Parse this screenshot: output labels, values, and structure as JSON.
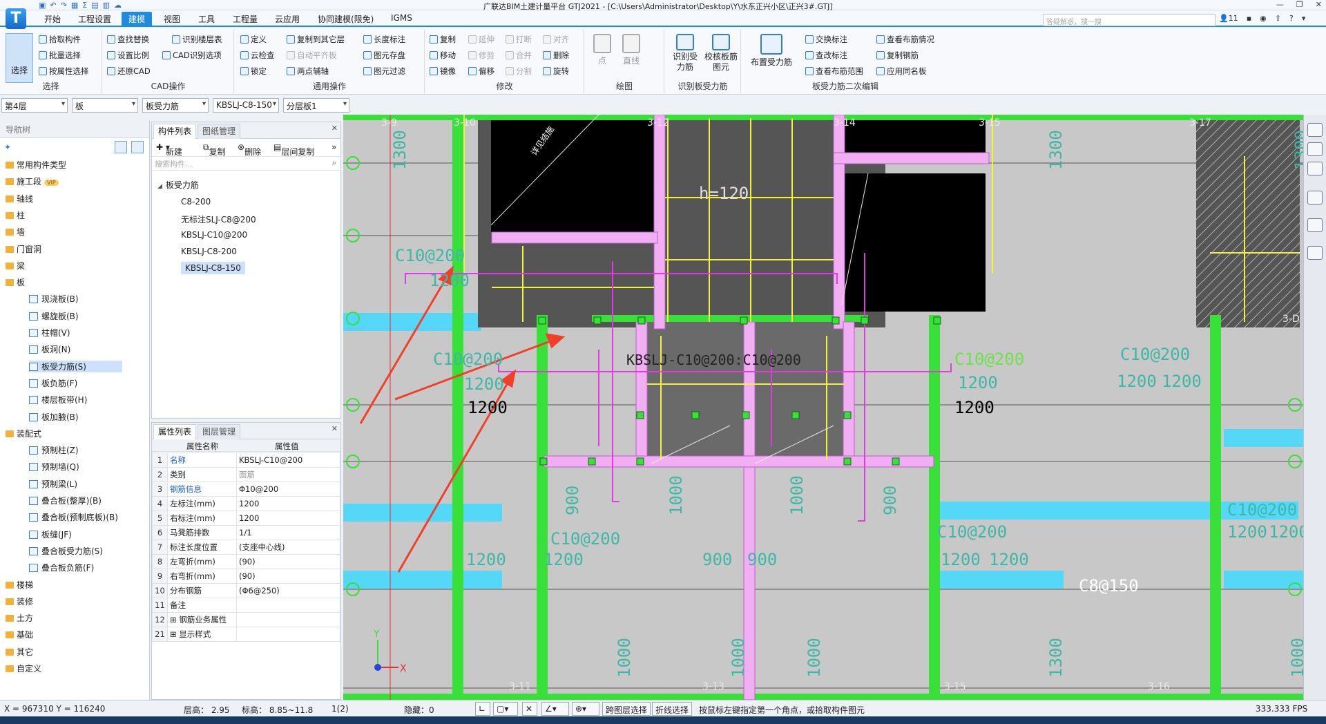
{
  "window": {
    "title": "广联达BIM土建计量平台 GTJ2021 - [C:\\Users\\Administrator\\Desktop\\Y\\水东正兴小区\\正兴3#.GTJ]",
    "logo": "T"
  },
  "menu": [
    "开始",
    "工程设置",
    "建模",
    "视图",
    "工具",
    "工程量",
    "云应用",
    "协同建模(限免)",
    "IGMS"
  ],
  "search_placeholder": "答疑解惑，搜一搜",
  "user_count": "11",
  "ribbon": {
    "select": {
      "big": "选择",
      "items": [
        "拾取构件",
        "批量选择",
        "按属性选择"
      ],
      "title": "选择"
    },
    "cad": {
      "items": [
        "查找替换",
        "识别楼层表",
        "设置比例",
        "CAD识别选项",
        "还原CAD"
      ],
      "title": "CAD操作"
    },
    "common": {
      "items": [
        "定义",
        "复制到其它层",
        "长度标注",
        "云检查",
        "自动平齐板",
        "图元存盘",
        "锁定",
        "两点辅轴",
        "图元过滤"
      ],
      "title": "通用操作"
    },
    "modify": {
      "items": [
        "复制",
        "延伸",
        "打断",
        "对齐",
        "移动",
        "修剪",
        "合并",
        "删除",
        "镜像",
        "偏移",
        "分割",
        "旋转"
      ],
      "title": "修改"
    },
    "draw": {
      "items": [
        "点",
        "直线"
      ],
      "title": "绘图"
    },
    "identify": {
      "items": [
        "识别受力筋",
        "校核板筋图元"
      ],
      "title": "识别板受力筋"
    },
    "edit": {
      "big": "布置受力筋",
      "items": [
        "交换标注",
        "查看布筋情况",
        "查改标注",
        "复制钢筋",
        "查看布筋范围",
        "应用同名板"
      ],
      "title": "板受力筋二次编辑"
    }
  },
  "combos": [
    "第4层",
    "板",
    "板受力筋",
    "KBSLJ-C8-150",
    "分层板1"
  ],
  "nav": {
    "title": "导航树",
    "items": [
      {
        "label": "常用构件类型",
        "level": 0
      },
      {
        "label": "施工段",
        "level": 0,
        "badge": "VIP"
      },
      {
        "label": "轴线",
        "level": 0
      },
      {
        "label": "柱",
        "level": 0
      },
      {
        "label": "墙",
        "level": 0
      },
      {
        "label": "门窗洞",
        "level": 0
      },
      {
        "label": "梁",
        "level": 0
      },
      {
        "label": "板",
        "level": 0
      },
      {
        "label": "现浇板(B)",
        "level": 1
      },
      {
        "label": "螺旋板(B)",
        "level": 1
      },
      {
        "label": "柱帽(V)",
        "level": 1
      },
      {
        "label": "板洞(N)",
        "level": 1
      },
      {
        "label": "板受力筋(S)",
        "level": 1,
        "selected": true
      },
      {
        "label": "板负筋(F)",
        "level": 1
      },
      {
        "label": "楼层板带(H)",
        "level": 1
      },
      {
        "label": "板加腋(B)",
        "level": 1
      },
      {
        "label": "装配式",
        "level": 0
      },
      {
        "label": "预制柱(Z)",
        "level": 1
      },
      {
        "label": "预制墙(Q)",
        "level": 1
      },
      {
        "label": "预制梁(L)",
        "level": 1
      },
      {
        "label": "叠合板(整厚)(B)",
        "level": 1
      },
      {
        "label": "叠合板(预制底板)(B)",
        "level": 1
      },
      {
        "label": "板缝(JF)",
        "level": 1
      },
      {
        "label": "叠合板受力筋(S)",
        "level": 1
      },
      {
        "label": "叠合板负筋(F)",
        "level": 1
      },
      {
        "label": "楼梯",
        "level": 0
      },
      {
        "label": "装修",
        "level": 0
      },
      {
        "label": "土方",
        "level": 0
      },
      {
        "label": "基础",
        "level": 0
      },
      {
        "label": "其它",
        "level": 0
      },
      {
        "label": "自定义",
        "level": 0
      }
    ]
  },
  "components": {
    "tabs": [
      "构件列表",
      "图纸管理"
    ],
    "toolbar": [
      "新建",
      "复制",
      "删除",
      "层间复制"
    ],
    "filter_placeholder": "搜索构件...",
    "group": "板受力筋",
    "items": [
      "C8-200",
      "无标注SLJ-C8@200",
      "KBSLJ-C10@200",
      "KBSLJ-C8-200",
      "KBSLJ-C8-150"
    ]
  },
  "props": {
    "tabs": [
      "属性列表",
      "图层管理"
    ],
    "header": [
      "属性名称",
      "属性值"
    ],
    "rows": [
      {
        "n": "1",
        "k": "名称",
        "v": "KBSLJ-C10@200",
        "blue": true
      },
      {
        "n": "2",
        "k": "类别",
        "v": "面筋",
        "gray": true
      },
      {
        "n": "3",
        "k": "钢筋信息",
        "v": "Φ10@200",
        "blue": true
      },
      {
        "n": "4",
        "k": "左标注(mm)",
        "v": "1200"
      },
      {
        "n": "5",
        "k": "右标注(mm)",
        "v": "1200"
      },
      {
        "n": "6",
        "k": "马凳筋排数",
        "v": "1/1"
      },
      {
        "n": "7",
        "k": "标注长度位置",
        "v": "(支座中心线)"
      },
      {
        "n": "8",
        "k": "左弯折(mm)",
        "v": "(90)"
      },
      {
        "n": "9",
        "k": "右弯折(mm)",
        "v": "(90)"
      },
      {
        "n": "10",
        "k": "分布钢筋",
        "v": "(Φ6@250)"
      },
      {
        "n": "11",
        "k": "备注",
        "v": ""
      },
      {
        "n": "12",
        "k": "钢筋业务属性",
        "v": "",
        "plus": true
      },
      {
        "n": "21",
        "k": "显示样式",
        "v": "",
        "plus": true
      }
    ]
  },
  "canvas": {
    "axis_labels": [
      "3-9",
      "3-10",
      "3-12",
      "3-14",
      "3-15",
      "3-17",
      "3-11",
      "3-13",
      "3-15",
      "3-16",
      "3-D"
    ],
    "rebar_labels": [
      {
        "t": "C10@200",
        "c": "#3fb7a6"
      },
      {
        "t": "1200",
        "c": "#3fb7a6"
      },
      {
        "t": "C10@200",
        "c": "#3fb7a6"
      },
      {
        "t": "1200",
        "c": "#3fb7a6"
      },
      {
        "t": "1200",
        "c": "#000"
      },
      {
        "t": "KBSLJ-C10@200:C10@200",
        "c": "#222"
      },
      {
        "t": "C10@200",
        "c": "#6fe04a"
      },
      {
        "t": "1200",
        "c": "#3fb7a6"
      },
      {
        "t": "1200",
        "c": "#000"
      },
      {
        "t": "C10@200",
        "c": "#3fb7a6"
      },
      {
        "t": "1200",
        "c": "#3fb7a6"
      },
      {
        "t": "1200",
        "c": "#3fb7a6"
      },
      {
        "t": "C10@200",
        "c": "#3fb7a6"
      },
      {
        "t": "1200",
        "c": "#3fb7a6"
      },
      {
        "t": "1200",
        "c": "#3fb7a6"
      },
      {
        "t": "C10@200",
        "c": "#3fb7a6"
      },
      {
        "t": "1200",
        "c": "#3fb7a6"
      },
      {
        "t": "1200",
        "c": "#3fb7a6"
      },
      {
        "t": "C10@200",
        "c": "#3fb7a6"
      },
      {
        "t": "1200",
        "c": "#3fb7a6"
      },
      {
        "t": "1200",
        "c": "#3fb7a6"
      },
      {
        "t": "900",
        "c": "#3fb7a6"
      },
      {
        "t": "900",
        "c": "#3fb7a6"
      },
      {
        "t": "C8@150",
        "c": "#fff"
      },
      {
        "t": "h=120",
        "c": "#e0e0e0"
      },
      {
        "t": "1300",
        "c": "#3fb7a6"
      },
      {
        "t": "1300",
        "c": "#3fb7a6"
      },
      {
        "t": "1300",
        "c": "#3fb7a6"
      },
      {
        "t": "900",
        "c": "#3fb7a6"
      },
      {
        "t": "1000",
        "c": "#3fb7a6"
      },
      {
        "t": "1000",
        "c": "#3fb7a6"
      },
      {
        "t": "900",
        "c": "#3fb7a6"
      },
      {
        "t": "1000",
        "c": "#3fb7a6"
      },
      {
        "t": "1000",
        "c": "#3fb7a6"
      },
      {
        "t": "1300",
        "c": "#3fb7a6"
      },
      {
        "t": "1000",
        "c": "#3fb7a6"
      },
      {
        "t": "1000",
        "c": "#3fb7a6"
      }
    ],
    "note_text": "详见结施",
    "axis_x": "X",
    "axis_y": "Y"
  },
  "status": {
    "coords": "X = 967310 Y = 116240",
    "floor_height": "层高： 2.95",
    "elevation": "标高： 8.85~11.8",
    "page": "1(2)",
    "hidden": "隐藏：0",
    "buttons": [
      "跨图层选择",
      "折线选择"
    ],
    "hint": "按鼠标左键指定第一个角点，或拾取构件图元",
    "fps": "333.333 FPS"
  },
  "colors": {
    "accent": "#1f8be0",
    "beam_pink": "#f2aef2",
    "rebar_yellow": "#f5f03a",
    "green": "#39e03a",
    "cyan": "#55d8f8",
    "red_arrow": "#f0402a"
  }
}
